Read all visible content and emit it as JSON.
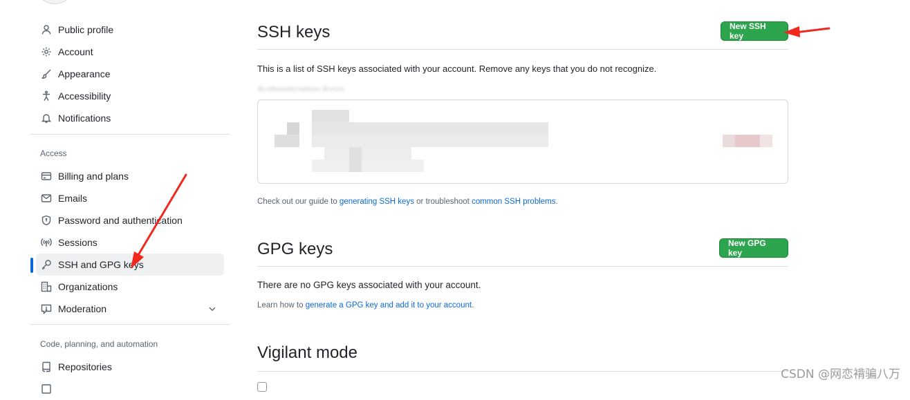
{
  "sidebar": {
    "items_top": [
      {
        "label": "Public profile",
        "icon": "person-icon"
      },
      {
        "label": "Account",
        "icon": "gear-icon"
      },
      {
        "label": "Appearance",
        "icon": "paintbrush-icon"
      },
      {
        "label": "Accessibility",
        "icon": "accessibility-icon"
      },
      {
        "label": "Notifications",
        "icon": "bell-icon"
      }
    ],
    "access_title": "Access",
    "items_access": [
      {
        "label": "Billing and plans",
        "icon": "credit-card-icon"
      },
      {
        "label": "Emails",
        "icon": "mail-icon"
      },
      {
        "label": "Password and authentication",
        "icon": "shield-lock-icon"
      },
      {
        "label": "Sessions",
        "icon": "broadcast-icon"
      },
      {
        "label": "SSH and GPG keys",
        "icon": "key-icon",
        "active": true
      },
      {
        "label": "Organizations",
        "icon": "organization-icon"
      },
      {
        "label": "Moderation",
        "icon": "report-icon"
      }
    ],
    "code_title": "Code, planning, and automation",
    "items_code": [
      {
        "label": "Repositories",
        "icon": "repo-icon"
      }
    ]
  },
  "ssh": {
    "title": "SSH keys",
    "new_button": "New SSH key",
    "description": "This is a list of SSH keys associated with your account. Remove any keys that you do not recognize.",
    "auth_keys_title": "Authentication Keys",
    "guide_prefix": "Check out our guide to ",
    "guide_link": "generating SSH keys",
    "guide_middle": " or troubleshoot ",
    "guide_link2": "common SSH problems",
    "guide_suffix": "."
  },
  "gpg": {
    "title": "GPG keys",
    "new_button": "New GPG key",
    "empty_text": "There are no GPG keys associated with your account.",
    "learn_prefix": "Learn how to ",
    "learn_link": "generate a GPG key and add it to your account",
    "learn_suffix": "."
  },
  "vigilant": {
    "title": "Vigilant mode"
  },
  "watermark": "CSDN @网恋褙骗八万",
  "colors": {
    "accent": "#0969da",
    "button_green": "#2da44e",
    "annotation_arrow": "#f0281e"
  }
}
